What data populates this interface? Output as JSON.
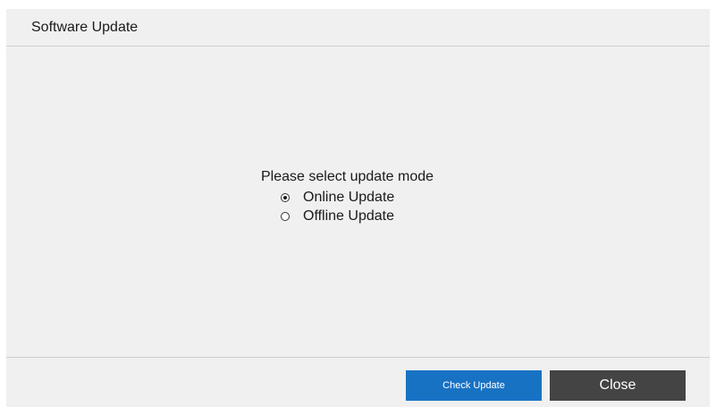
{
  "dialog": {
    "title": "Software Update",
    "prompt": "Please select update mode",
    "options": [
      {
        "label": "Online Update",
        "selected": true
      },
      {
        "label": "Offline Update",
        "selected": false
      }
    ],
    "buttons": {
      "check_update": "Check Update",
      "close": "Close"
    },
    "colors": {
      "primary_button": "#1872c4",
      "secondary_button": "#444444",
      "background": "#f0f0f0"
    }
  }
}
